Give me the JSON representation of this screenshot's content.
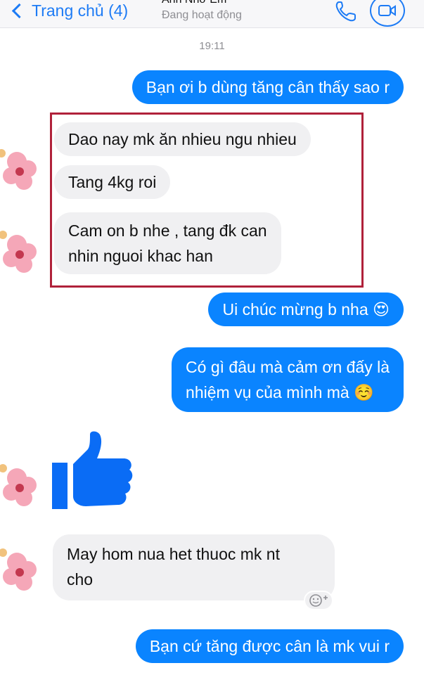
{
  "header": {
    "back_label": "Trang chủ (4)",
    "contact_name": "Anh Nhớ Em",
    "status": "Đang hoạt động"
  },
  "timestamp": "19:11",
  "messages": [
    {
      "from": "me",
      "text": "Bạn ơi b dùng tăng cân thấy sao r"
    },
    {
      "from": "them",
      "text": "Dao nay mk ăn nhieu ngu nhieu"
    },
    {
      "from": "them",
      "text": "Tang 4kg roi"
    },
    {
      "from": "them",
      "lines": [
        "Cam on b nhe , tang đk can",
        "nhin nguoi khac han"
      ]
    },
    {
      "from": "me",
      "text": "Ui chúc mừng b nha 😍"
    },
    {
      "from": "me",
      "lines": [
        "Có gì đâu mà cảm ơn đấy là",
        "nhiệm vụ của mình mà ☺️"
      ]
    },
    {
      "from": "them",
      "sticker": "thumbs-up"
    },
    {
      "from": "them",
      "lines": [
        "May hom nua het thuoc mk nt",
        "cho"
      ]
    },
    {
      "from": "me",
      "text": "Bạn cứ tăng được cân là mk vui r"
    }
  ],
  "colors": {
    "outgoing_bubble": "#0a84ff",
    "incoming_bubble": "#f0f0f2",
    "accent": "#1d7bf5",
    "highlight_border": "#b0213a"
  },
  "icons": [
    "chevron-left-icon",
    "phone-icon",
    "video-call-icon",
    "thumbs-up-icon",
    "add-reaction-icon",
    "flower-avatar-icon"
  ]
}
